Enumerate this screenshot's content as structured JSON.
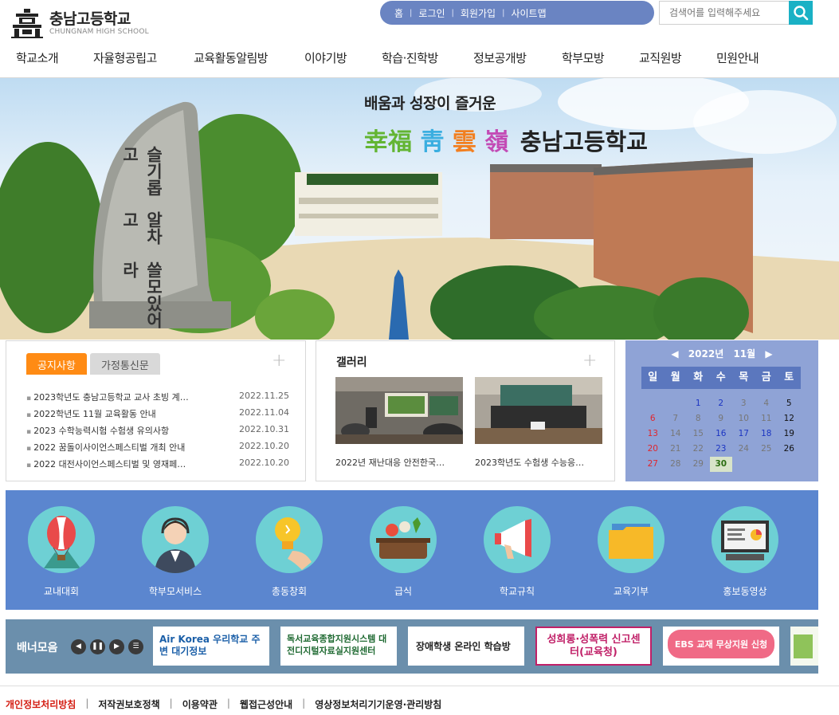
{
  "header": {
    "logo_name": "충남고등학교",
    "logo_sub": "CHUNGNAM HIGH SCHOOL",
    "util_links": [
      "홈",
      "로그인",
      "회원가입",
      "사이트맵"
    ],
    "search_placeholder": "검색어를 입력해주세요"
  },
  "gnb": [
    "학교소개",
    "자율형공립고",
    "교육활동알림방",
    "이야기방",
    "학습·진학방",
    "정보공개방",
    "학부모방",
    "교직원방",
    "민원안내"
  ],
  "hero": {
    "slogan": "배움과 성장이 즐거운",
    "hanja": [
      "幸福",
      "靑",
      "雲",
      "嶺"
    ],
    "school": "충남고등학교",
    "stone_text": [
      "슬기롭고",
      "알차고",
      "쓸모있어라"
    ]
  },
  "notice": {
    "tabs": [
      "공지사항",
      "가정통신문"
    ],
    "items": [
      {
        "title": "2023학년도 충남고등학교 교사 초빙 계…",
        "date": "2022.11.25"
      },
      {
        "title": "2022학년도 11월 교육활동 안내",
        "date": "2022.11.04"
      },
      {
        "title": "2023 수학능력시험 수험생 유의사항",
        "date": "2022.10.31"
      },
      {
        "title": "2022 꿈돌이사이언스페스티벌 개최 안내",
        "date": "2022.10.20"
      },
      {
        "title": "2022 대전사이언스페스티벌 및 영재페…",
        "date": "2022.10.20"
      }
    ]
  },
  "gallery": {
    "title": "갤러리",
    "items": [
      {
        "caption": "2022년 재난대응 안전한국…"
      },
      {
        "caption": "2023학년도 수험생 수능응…"
      }
    ]
  },
  "calendar": {
    "year": "2022년",
    "month": "11월",
    "dow": [
      "일",
      "월",
      "화",
      "수",
      "목",
      "금",
      "토"
    ],
    "weeks": [
      [
        "",
        "",
        "1",
        "2",
        "3",
        "4",
        "5"
      ],
      [
        "6",
        "7",
        "8",
        "9",
        "10",
        "11",
        "12"
      ],
      [
        "13",
        "14",
        "15",
        "16",
        "17",
        "18",
        "19"
      ],
      [
        "20",
        "21",
        "22",
        "23",
        "24",
        "25",
        "26"
      ],
      [
        "27",
        "28",
        "29",
        "30",
        "",
        "",
        ""
      ]
    ],
    "event_days": [
      "1",
      "2",
      "16",
      "17",
      "18",
      "23"
    ],
    "today": "30"
  },
  "quick_menu": [
    "교내대회",
    "학부모서비스",
    "총동창회",
    "급식",
    "학교규칙",
    "교육기부",
    "홍보동영상"
  ],
  "banners": {
    "title": "배너모음",
    "items": [
      {
        "text": "Air Korea 우리학교 주변 대기정보"
      },
      {
        "text": "독서교육종합지원시스템 대전디지털자료실지원센터"
      },
      {
        "text": "장애학생 온라인 학습방"
      },
      {
        "text": "성희롱·성폭력 신고센터(교육청)"
      },
      {
        "text": "EBS 교재 무상지원 신청"
      }
    ]
  },
  "footer": [
    "개인정보처리방침",
    "저작권보호정책",
    "이용약관",
    "웹접근성안내",
    "영상정보처리기기운영·관리방침"
  ]
}
